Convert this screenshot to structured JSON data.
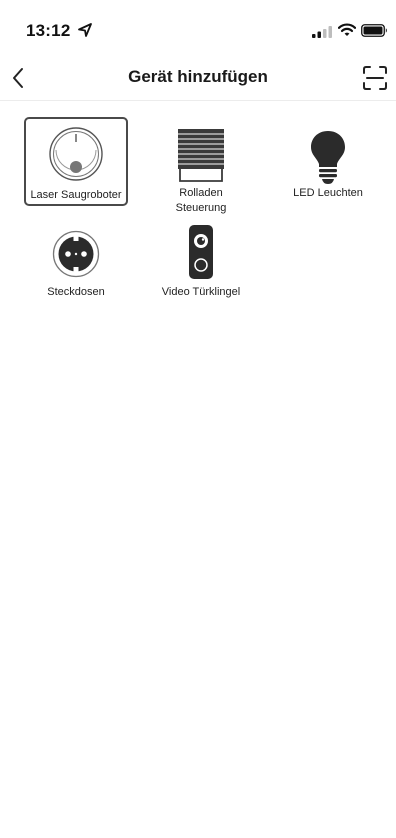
{
  "status_bar": {
    "time": "13:12"
  },
  "nav": {
    "title": "Gerät hinzufügen"
  },
  "devices": [
    {
      "label": "Laser Saugroboter",
      "icon": "robot-vacuum-icon",
      "selected": true
    },
    {
      "label": "Rolladen Steuerung",
      "label_line1": "Rolladen",
      "label_line2": "Steuerung",
      "icon": "roller-shutter-icon",
      "selected": false
    },
    {
      "label": "LED Leuchten",
      "icon": "light-bulb-icon",
      "selected": false
    },
    {
      "label": "Steckdosen",
      "icon": "power-socket-icon",
      "selected": false
    },
    {
      "label": "Video Türklingel",
      "icon": "video-doorbell-icon",
      "selected": false
    }
  ]
}
